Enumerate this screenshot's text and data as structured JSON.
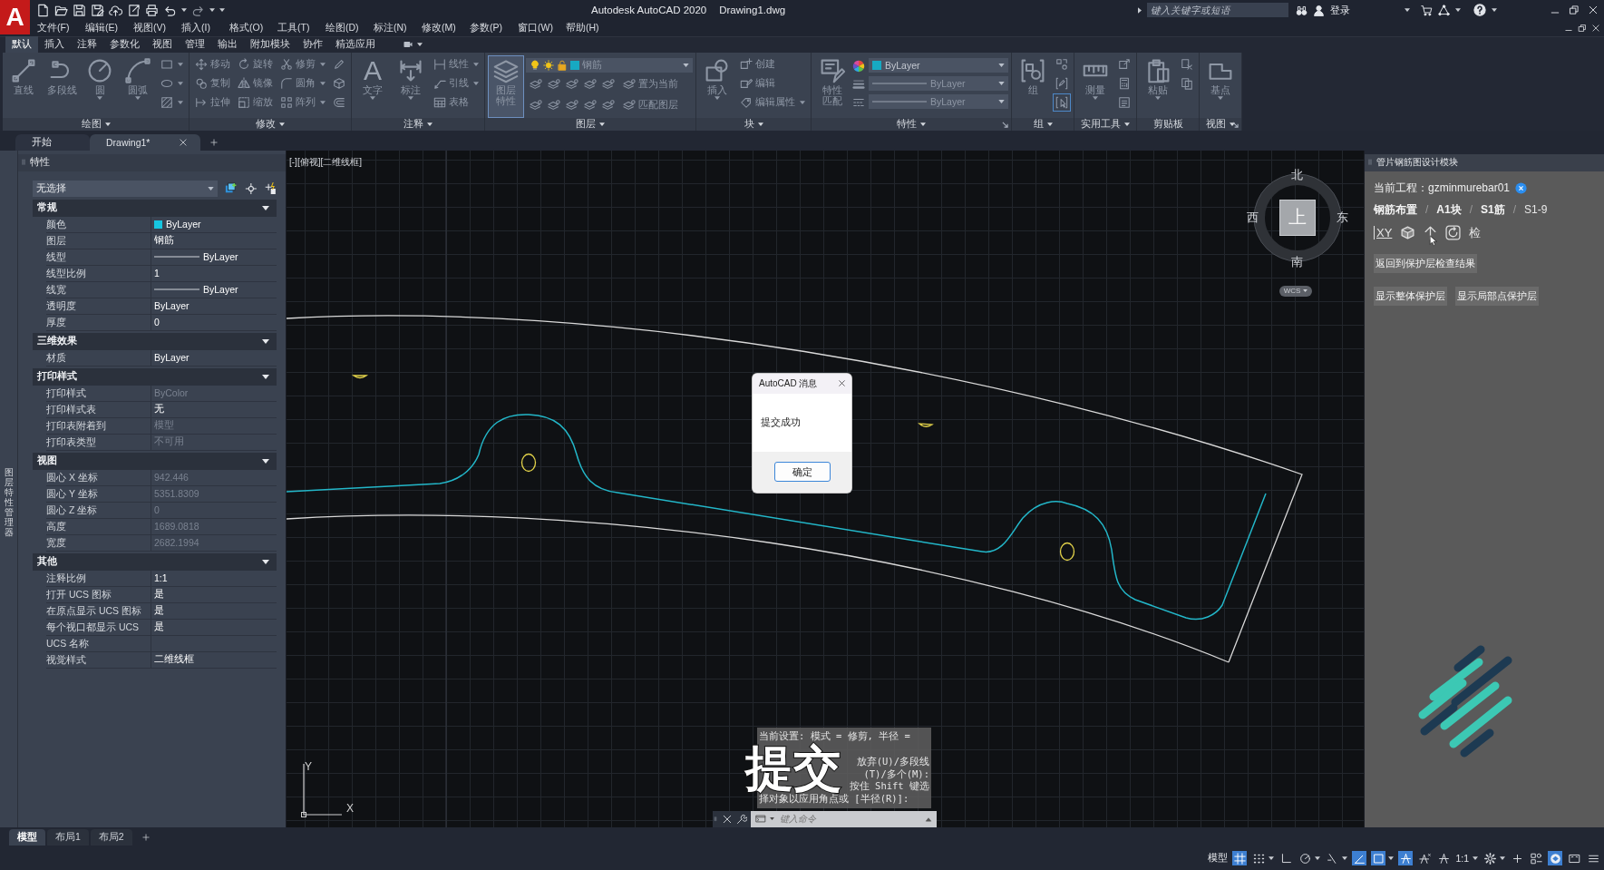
{
  "title_bar": {
    "logo": "A",
    "app_title": "Autodesk AutoCAD 2020",
    "document": "Drawing1.dwg",
    "search": {
      "placeholder": "键入关键字或短语"
    },
    "sign_in": "登录"
  },
  "menu_bar": [
    "文件(F)",
    "编辑(E)",
    "视图(V)",
    "插入(I)",
    "格式(O)",
    "工具(T)",
    "绘图(D)",
    "标注(N)",
    "修改(M)",
    "参数(P)",
    "窗口(W)",
    "帮助(H)"
  ],
  "ribbon": {
    "tabs": [
      {
        "label": "默认",
        "selected": true
      },
      {
        "label": "插入",
        "selected": false
      },
      {
        "label": "注释",
        "selected": false
      },
      {
        "label": "参数化",
        "selected": false
      },
      {
        "label": "视图",
        "selected": false
      },
      {
        "label": "管理",
        "selected": false
      },
      {
        "label": "输出",
        "selected": false
      },
      {
        "label": "附加模块",
        "selected": false
      },
      {
        "label": "协作",
        "selected": false
      },
      {
        "label": "精选应用",
        "selected": false
      }
    ],
    "panels": [
      {
        "title": "绘图",
        "menu": true,
        "launcher": false,
        "columns": [
          {
            "kind": "large",
            "label": "直线",
            "caret": false,
            "on": false
          },
          {
            "kind": "large",
            "label": "多段线",
            "caret": false,
            "on": false
          },
          {
            "kind": "large",
            "label": "圆",
            "caret": true,
            "on": false
          },
          {
            "kind": "large",
            "label": "圆弧",
            "caret": true,
            "on": false
          },
          {
            "kind": "stack",
            "items": [
              {
                "caret": true
              },
              {
                "caret": true
              },
              {
                "caret": true
              }
            ]
          }
        ]
      },
      {
        "title": "修改",
        "menu": true,
        "launcher": false,
        "columns": [
          {
            "kind": "stack",
            "items": [
              {
                "label": "移动",
                "caret": false
              },
              {
                "label": "复制",
                "caret": false
              },
              {
                "label": "拉伸",
                "caret": false
              }
            ]
          },
          {
            "kind": "stack",
            "items": [
              {
                "label": "旋转",
                "caret": false
              },
              {
                "label": "镜像",
                "caret": false
              },
              {
                "label": "缩放",
                "caret": false
              }
            ]
          },
          {
            "kind": "stack",
            "items": [
              {
                "label": "修剪",
                "caret": true
              },
              {
                "label": "圆角",
                "caret": true
              },
              {
                "label": "阵列",
                "caret": true
              }
            ]
          },
          {
            "kind": "stack",
            "items": [
              {
                "caret": false
              },
              {
                "caret": false
              },
              {
                "caret": false
              }
            ]
          }
        ]
      },
      {
        "title": "注释",
        "menu": true,
        "launcher": false,
        "columns": [
          {
            "kind": "large",
            "glyph": "A",
            "label": "文字",
            "caret": true,
            "on": false
          },
          {
            "kind": "large",
            "label": "标注",
            "caret": true,
            "on": false
          },
          {
            "kind": "stack",
            "items": [
              {
                "label": "线性",
                "caret": true
              },
              {
                "label": "引线",
                "caret": true
              },
              {
                "label": "表格",
                "caret": false
              }
            ]
          }
        ]
      },
      {
        "title": "图层",
        "menu": true,
        "launcher": false,
        "columns": [
          {
            "kind": "large",
            "label": "图层特性",
            "caret": false,
            "on": true
          },
          {
            "kind": "layers",
            "layer": {
              "label": "钢筋",
              "color": "#17a9c2"
            },
            "actions": [
              "置为当前",
              "匹配图层"
            ]
          }
        ]
      },
      {
        "title": "块",
        "menu": true,
        "launcher": false,
        "columns": [
          {
            "kind": "large",
            "label": "插入",
            "caret": true,
            "on": false
          },
          {
            "kind": "stack",
            "items": [
              {
                "label": "创建",
                "caret": false
              },
              {
                "label": "编辑",
                "caret": false
              },
              {
                "label": "编辑属性",
                "caret": true
              }
            ]
          }
        ]
      },
      {
        "title": "特性",
        "menu": true,
        "launcher": true,
        "columns": [
          {
            "kind": "large",
            "label": "特性匹配",
            "caret": false,
            "on": false
          },
          {
            "kind": "properties",
            "items": [
              {
                "kind": "color",
                "label": "ByLayer",
                "color": "#17a9c2",
                "disabled": false
              },
              {
                "kind": "line",
                "label": "ByLayer",
                "disabled": true
              },
              {
                "kind": "line",
                "label": "ByLayer",
                "disabled": true
              }
            ]
          }
        ]
      },
      {
        "title": "组",
        "menu": true,
        "launcher": false,
        "columns": [
          {
            "kind": "large",
            "label": "组",
            "caret": false,
            "on": false
          },
          {
            "kind": "stack",
            "items": [
              {
                "on": false
              },
              {
                "on": false
              },
              {
                "on": true
              }
            ]
          }
        ]
      },
      {
        "title": "实用工具",
        "menu": true,
        "launcher": false,
        "columns": [
          {
            "kind": "large",
            "label": "测量",
            "caret": true,
            "on": false
          },
          {
            "kind": "stack",
            "items": [
              {
                "caret": false
              },
              {
                "caret": false
              },
              {
                "caret": false
              }
            ]
          }
        ]
      },
      {
        "title": "剪贴板",
        "menu": false,
        "launcher": false,
        "columns": [
          {
            "kind": "large",
            "label": "粘贴",
            "caret": true,
            "on": false
          },
          {
            "kind": "stack",
            "items": [
              {
                "caret": false
              },
              {
                "caret": false
              }
            ]
          }
        ]
      },
      {
        "title": "视图",
        "menu": true,
        "launcher": true,
        "columns": [
          {
            "kind": "large",
            "label": "基点",
            "caret": true,
            "on": false
          }
        ]
      }
    ]
  },
  "document_tabs": [
    {
      "label": "开始",
      "selected": false,
      "closable": false
    },
    {
      "label": "Drawing1*",
      "selected": true,
      "closable": true
    }
  ],
  "side_strip": {
    "label": "图层特性管理器"
  },
  "properties_palette": {
    "title": "特性",
    "selection": "无选择",
    "sections": [
      {
        "title": "常规",
        "expanded": true,
        "rows": [
          {
            "label": "颜色",
            "kind": "swatch",
            "color": "#16c6e0",
            "value": "ByLayer",
            "disabled": false
          },
          {
            "label": "图层",
            "kind": "text",
            "value": "钢筋",
            "disabled": false
          },
          {
            "label": "线型",
            "kind": "line",
            "value": "ByLayer",
            "disabled": false
          },
          {
            "label": "线型比例",
            "kind": "text",
            "value": "1",
            "disabled": false
          },
          {
            "label": "线宽",
            "kind": "line",
            "value": "ByLayer",
            "disabled": false
          },
          {
            "label": "透明度",
            "kind": "text",
            "value": "ByLayer",
            "disabled": false
          },
          {
            "label": "厚度",
            "kind": "text",
            "value": "0",
            "disabled": false
          }
        ]
      },
      {
        "title": "三维效果",
        "expanded": true,
        "rows": [
          {
            "label": "材质",
            "kind": "text",
            "value": "ByLayer",
            "disabled": false
          }
        ]
      },
      {
        "title": "打印样式",
        "expanded": true,
        "rows": [
          {
            "label": "打印样式",
            "kind": "text",
            "value": "ByColor",
            "disabled": true
          },
          {
            "label": "打印样式表",
            "kind": "text",
            "value": "无",
            "disabled": false
          },
          {
            "label": "打印表附着到",
            "kind": "text",
            "value": "模型",
            "disabled": true
          },
          {
            "label": "打印表类型",
            "kind": "text",
            "value": "不可用",
            "disabled": true
          }
        ]
      },
      {
        "title": "视图",
        "expanded": true,
        "rows": [
          {
            "label": "圆心 X 坐标",
            "kind": "text",
            "value": "942.446",
            "disabled": true
          },
          {
            "label": "圆心 Y 坐标",
            "kind": "text",
            "value": "5351.8309",
            "disabled": true
          },
          {
            "label": "圆心 Z 坐标",
            "kind": "text",
            "value": "0",
            "disabled": true
          },
          {
            "label": "高度",
            "kind": "text",
            "value": "1689.0818",
            "disabled": true
          },
          {
            "label": "宽度",
            "kind": "text",
            "value": "2682.1994",
            "disabled": true
          }
        ]
      },
      {
        "title": "其他",
        "expanded": true,
        "rows": [
          {
            "label": "注释比例",
            "kind": "text",
            "value": "1:1",
            "disabled": false
          },
          {
            "label": "打开 UCS 图标",
            "kind": "text",
            "value": "是",
            "disabled": false
          },
          {
            "label": "在原点显示 UCS 图标",
            "kind": "text",
            "value": "是",
            "disabled": false
          },
          {
            "label": "每个视口都显示 UCS",
            "kind": "text",
            "value": "是",
            "disabled": false
          },
          {
            "label": "UCS 名称",
            "kind": "text"
          },
          {
            "label": "视觉样式",
            "kind": "text",
            "value": "二维线框",
            "disabled": false
          }
        ]
      }
    ]
  },
  "viewport": {
    "label": "[-][俯视][二维线框]",
    "viewcube": {
      "north": "北",
      "south": "南",
      "west": "西",
      "east": "东",
      "face": "上",
      "coordinate_system": "WCS"
    },
    "ucs": {
      "y": "Y",
      "x": "X"
    },
    "dialog": {
      "title": "AutoCAD 消息",
      "message": "提交成功",
      "button": "确定"
    },
    "command_line": {
      "history": [
        {
          "text": "当前设置: 模式 = 修剪, 半径 =",
          "partial": false
        },
        {
          "text": "放弃(U)/多段线",
          "partial": true
        },
        {
          "text": "(T)/多个(M):",
          "partial": true
        },
        {
          "text": "按住 Shift 键选",
          "partial": true
        },
        {
          "text": "择对象以应用角点或 [半径(R)]:",
          "partial": false
        }
      ],
      "placeholder": "键入命令"
    },
    "subtitle": "提交"
  },
  "design_palette": {
    "title": "管片钢筋图设计模块",
    "project": "当前工程：gzminmurebar01",
    "breadcrumb": [
      {
        "label": "钢筋布置",
        "current": false
      },
      {
        "label": "A1块",
        "current": false,
        "separator": "/"
      },
      {
        "label": "S1筋",
        "current": false,
        "separator": "/"
      },
      {
        "label": "S1-9",
        "current": true,
        "separator": "/"
      }
    ],
    "tools": [
      {
        "kind": "text",
        "label": "XY"
      },
      {
        "kind": "cube"
      },
      {
        "kind": "arrow"
      },
      {
        "kind": "rotate"
      },
      {
        "kind": "text",
        "label": "检"
      }
    ],
    "buttons": [
      [
        "返回到保护层检查结果"
      ],
      [
        "显示整体保护层",
        "显示局部点保护层"
      ]
    ]
  },
  "layout_tabs": [
    {
      "label": "模型",
      "selected": true
    },
    {
      "label": "布局1",
      "selected": false
    },
    {
      "label": "布局2",
      "selected": false
    }
  ],
  "status_bar": {
    "items": [
      {
        "kind": "text",
        "label": "模型",
        "menu": false
      },
      {
        "kind": "toggle",
        "on": true,
        "menu": false
      },
      {
        "kind": "toggle",
        "on": false,
        "menu": true
      },
      {
        "kind": "toggle",
        "on": false,
        "menu": false
      },
      {
        "kind": "toggle",
        "on": false,
        "menu": true
      },
      {
        "kind": "toggle",
        "on": false,
        "menu": true
      },
      {
        "kind": "toggle",
        "on": true,
        "menu": false
      },
      {
        "kind": "toggle",
        "on": true,
        "menu": true
      },
      {
        "kind": "toggle",
        "on": true,
        "menu": false
      },
      {
        "kind": "toggle",
        "on": false,
        "menu": false
      },
      {
        "kind": "toggle",
        "on": false,
        "menu": false
      },
      {
        "kind": "text",
        "label": "1:1",
        "menu": true
      },
      {
        "kind": "toggle",
        "on": false,
        "menu": true
      },
      {
        "kind": "toggle",
        "on": false,
        "menu": false
      },
      {
        "kind": "toggle",
        "on": false,
        "menu": false
      },
      {
        "kind": "toggle",
        "on": true,
        "menu": false
      },
      {
        "kind": "toggle",
        "on": false,
        "menu": false
      },
      {
        "kind": "toggle",
        "on": false,
        "menu": false
      }
    ]
  }
}
